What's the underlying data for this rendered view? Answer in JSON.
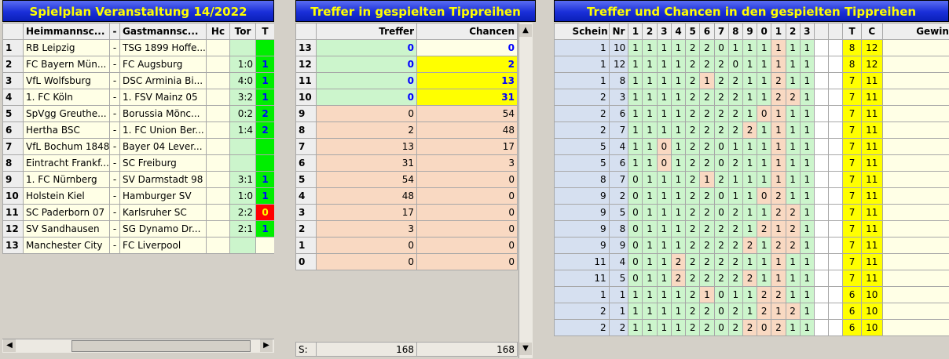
{
  "panel1": {
    "title": "Spielplan Veranstaltung 14/2022",
    "headers": {
      "num": "",
      "home": "Heimmannsc...",
      "sep": "-",
      "away": "Gastmannsc...",
      "hc": "Hc",
      "tor": "Tor",
      "t": "T"
    },
    "rows": [
      {
        "num": "1",
        "home": "RB Leipzig",
        "sep": "-",
        "away": "TSG 1899 Hoffe...",
        "tor": "",
        "t": "",
        "state": "g"
      },
      {
        "num": "2",
        "home": "FC Bayern Mün...",
        "sep": "-",
        "away": "FC Augsburg",
        "tor": "1:0",
        "t": "1",
        "state": "g"
      },
      {
        "num": "3",
        "home": "VfL Wolfsburg",
        "sep": "-",
        "away": "DSC Arminia Bi...",
        "tor": "4:0",
        "t": "1",
        "state": "g"
      },
      {
        "num": "4",
        "home": "1. FC Köln",
        "sep": "-",
        "away": "1. FSV Mainz 05",
        "tor": "3:2",
        "t": "1",
        "state": "g"
      },
      {
        "num": "5",
        "home": "SpVgg Greuthe...",
        "sep": "-",
        "away": "Borussia Mönc...",
        "tor": "0:2",
        "t": "2",
        "state": "g"
      },
      {
        "num": "6",
        "home": "Hertha BSC",
        "sep": "-",
        "away": "1. FC Union Ber...",
        "tor": "1:4",
        "t": "2",
        "state": "g"
      },
      {
        "num": "7",
        "home": "VfL Bochum 1848",
        "sep": "-",
        "away": "Bayer 04 Lever...",
        "tor": "",
        "t": "",
        "state": "g"
      },
      {
        "num": "8",
        "home": "Eintracht Frankf...",
        "sep": "-",
        "away": "SC Freiburg",
        "tor": "",
        "t": "",
        "state": "g"
      },
      {
        "num": "9",
        "home": "1. FC Nürnberg",
        "sep": "-",
        "away": "SV Darmstadt 98",
        "tor": "3:1",
        "t": "1",
        "state": "g"
      },
      {
        "num": "10",
        "home": "Holstein Kiel",
        "sep": "-",
        "away": "Hamburger SV",
        "tor": "1:0",
        "t": "1",
        "state": "g"
      },
      {
        "num": "11",
        "home": "SC Paderborn 07",
        "sep": "-",
        "away": "Karlsruher SC",
        "tor": "2:2",
        "t": "0",
        "state": "r"
      },
      {
        "num": "12",
        "home": "SV Sandhausen",
        "sep": "-",
        "away": "SG Dynamo Dr...",
        "tor": "2:1",
        "t": "1",
        "state": "g"
      },
      {
        "num": "13",
        "home": "Manchester City",
        "sep": "-",
        "away": "FC Liverpool",
        "tor": "",
        "t": "",
        "state": "n"
      }
    ]
  },
  "panel2": {
    "title": "Treffer in gespielten Tippreihen",
    "headers": {
      "treffer": "Treffer",
      "chancen": "Chancen"
    },
    "rows": [
      {
        "n": "13",
        "treffer": "0",
        "chancen": "0",
        "style": "top"
      },
      {
        "n": "12",
        "treffer": "0",
        "chancen": "2",
        "style": "topY"
      },
      {
        "n": "11",
        "treffer": "0",
        "chancen": "13",
        "style": "topY"
      },
      {
        "n": "10",
        "treffer": "0",
        "chancen": "31",
        "style": "topY"
      },
      {
        "n": "9",
        "treffer": "0",
        "chancen": "54",
        "style": "low"
      },
      {
        "n": "8",
        "treffer": "2",
        "chancen": "48",
        "style": "low"
      },
      {
        "n": "7",
        "treffer": "13",
        "chancen": "17",
        "style": "low"
      },
      {
        "n": "6",
        "treffer": "31",
        "chancen": "3",
        "style": "low"
      },
      {
        "n": "5",
        "treffer": "54",
        "chancen": "0",
        "style": "low"
      },
      {
        "n": "4",
        "treffer": "48",
        "chancen": "0",
        "style": "low"
      },
      {
        "n": "3",
        "treffer": "17",
        "chancen": "0",
        "style": "low"
      },
      {
        "n": "2",
        "treffer": "3",
        "chancen": "0",
        "style": "low"
      },
      {
        "n": "1",
        "treffer": "0",
        "chancen": "0",
        "style": "low"
      },
      {
        "n": "0",
        "treffer": "0",
        "chancen": "0",
        "style": "low"
      }
    ],
    "sum": {
      "label": "S:",
      "treffer": "168",
      "chancen": "168"
    }
  },
  "panel3": {
    "title": "Treffer und Chancen in den gespielten Tippreihen",
    "headers": [
      "Schein",
      "Nr",
      "1",
      "2",
      "3",
      "4",
      "5",
      "6",
      "7",
      "8",
      "9",
      "0",
      "1",
      "2",
      "3",
      "",
      "",
      "T",
      "C",
      "Gewinn €"
    ],
    "rows": [
      {
        "schein": "1",
        "nr": "10",
        "tips": [
          "1",
          "1",
          "1",
          "1",
          "2",
          "2",
          "0",
          "1",
          "1",
          "1",
          "1",
          "1",
          "1"
        ],
        "t": "8",
        "c": "12"
      },
      {
        "schein": "1",
        "nr": "12",
        "tips": [
          "1",
          "1",
          "1",
          "1",
          "2",
          "2",
          "2",
          "0",
          "1",
          "1",
          "1",
          "1",
          "1"
        ],
        "t": "8",
        "c": "12"
      },
      {
        "schein": "1",
        "nr": "8",
        "tips": [
          "1",
          "1",
          "1",
          "1",
          "2",
          "1",
          "2",
          "2",
          "1",
          "1",
          "2",
          "1",
          "1"
        ],
        "t": "7",
        "c": "11"
      },
      {
        "schein": "2",
        "nr": "3",
        "tips": [
          "1",
          "1",
          "1",
          "1",
          "2",
          "2",
          "2",
          "2",
          "1",
          "1",
          "2",
          "2",
          "1"
        ],
        "t": "7",
        "c": "11"
      },
      {
        "schein": "2",
        "nr": "6",
        "tips": [
          "1",
          "1",
          "1",
          "1",
          "2",
          "2",
          "2",
          "2",
          "1",
          "0",
          "1",
          "1",
          "1"
        ],
        "t": "7",
        "c": "11"
      },
      {
        "schein": "2",
        "nr": "7",
        "tips": [
          "1",
          "1",
          "1",
          "1",
          "2",
          "2",
          "2",
          "2",
          "2",
          "1",
          "1",
          "1",
          "1"
        ],
        "t": "7",
        "c": "11"
      },
      {
        "schein": "5",
        "nr": "4",
        "tips": [
          "1",
          "1",
          "0",
          "1",
          "2",
          "2",
          "0",
          "1",
          "1",
          "1",
          "1",
          "1",
          "1"
        ],
        "t": "7",
        "c": "11"
      },
      {
        "schein": "5",
        "nr": "6",
        "tips": [
          "1",
          "1",
          "0",
          "1",
          "2",
          "2",
          "0",
          "2",
          "1",
          "1",
          "1",
          "1",
          "1"
        ],
        "t": "7",
        "c": "11"
      },
      {
        "schein": "8",
        "nr": "7",
        "tips": [
          "0",
          "1",
          "1",
          "1",
          "2",
          "1",
          "2",
          "1",
          "1",
          "1",
          "1",
          "1",
          "1"
        ],
        "t": "7",
        "c": "11"
      },
      {
        "schein": "9",
        "nr": "2",
        "tips": [
          "0",
          "1",
          "1",
          "1",
          "2",
          "2",
          "0",
          "1",
          "1",
          "0",
          "2",
          "1",
          "1"
        ],
        "t": "7",
        "c": "11"
      },
      {
        "schein": "9",
        "nr": "5",
        "tips": [
          "0",
          "1",
          "1",
          "1",
          "2",
          "2",
          "0",
          "2",
          "1",
          "1",
          "2",
          "2",
          "1"
        ],
        "t": "7",
        "c": "11"
      },
      {
        "schein": "9",
        "nr": "8",
        "tips": [
          "0",
          "1",
          "1",
          "1",
          "2",
          "2",
          "2",
          "2",
          "1",
          "2",
          "1",
          "2",
          "1"
        ],
        "t": "7",
        "c": "11"
      },
      {
        "schein": "9",
        "nr": "9",
        "tips": [
          "0",
          "1",
          "1",
          "1",
          "2",
          "2",
          "2",
          "2",
          "2",
          "1",
          "2",
          "2",
          "1"
        ],
        "t": "7",
        "c": "11"
      },
      {
        "schein": "11",
        "nr": "4",
        "tips": [
          "0",
          "1",
          "1",
          "2",
          "2",
          "2",
          "2",
          "2",
          "1",
          "1",
          "1",
          "1",
          "1"
        ],
        "t": "7",
        "c": "11"
      },
      {
        "schein": "11",
        "nr": "5",
        "tips": [
          "0",
          "1",
          "1",
          "2",
          "2",
          "2",
          "2",
          "2",
          "2",
          "1",
          "1",
          "1",
          "1"
        ],
        "t": "7",
        "c": "11"
      },
      {
        "schein": "1",
        "nr": "1",
        "tips": [
          "1",
          "1",
          "1",
          "1",
          "2",
          "1",
          "0",
          "1",
          "1",
          "2",
          "2",
          "1",
          "1"
        ],
        "t": "6",
        "c": "10"
      },
      {
        "schein": "2",
        "nr": "1",
        "tips": [
          "1",
          "1",
          "1",
          "1",
          "2",
          "2",
          "0",
          "2",
          "1",
          "2",
          "1",
          "2",
          "1"
        ],
        "t": "6",
        "c": "10"
      },
      {
        "schein": "2",
        "nr": "2",
        "tips": [
          "1",
          "1",
          "1",
          "1",
          "2",
          "2",
          "0",
          "2",
          "2",
          "0",
          "2",
          "1",
          "1"
        ],
        "t": "6",
        "c": "10"
      }
    ]
  },
  "results": [
    "",
    "1",
    "1",
    "1",
    "2",
    "2",
    "",
    "",
    "1",
    "1",
    "0",
    "1",
    ""
  ]
}
